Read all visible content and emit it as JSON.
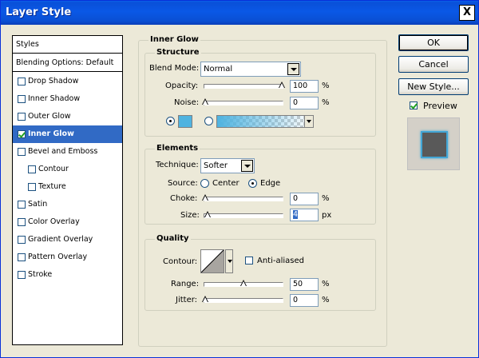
{
  "window": {
    "title": "Layer Style",
    "close_glyph": "X"
  },
  "left_panel": {
    "styles_label": "Styles",
    "blending_label": "Blending Options: Default",
    "items": [
      {
        "label": "Drop Shadow",
        "checked": false
      },
      {
        "label": "Inner Shadow",
        "checked": false
      },
      {
        "label": "Outer Glow",
        "checked": false
      },
      {
        "label": "Inner Glow",
        "checked": true,
        "selected": true
      },
      {
        "label": "Bevel and Emboss",
        "checked": false
      },
      {
        "label": "Contour",
        "checked": false,
        "indent": true
      },
      {
        "label": "Texture",
        "checked": false,
        "indent": true
      },
      {
        "label": "Satin",
        "checked": false
      },
      {
        "label": "Color Overlay",
        "checked": false
      },
      {
        "label": "Gradient Overlay",
        "checked": false
      },
      {
        "label": "Pattern Overlay",
        "checked": false
      },
      {
        "label": "Stroke",
        "checked": false
      }
    ]
  },
  "main": {
    "section_title": "Inner Glow",
    "structure": {
      "title": "Structure",
      "blend_mode_label": "Blend Mode:",
      "blend_mode_value": "Normal",
      "opacity_label": "Opacity:",
      "opacity_value": "100",
      "opacity_level": 100,
      "noise_label": "Noise:",
      "noise_value": "0",
      "noise_level": 0,
      "unit_percent": "%",
      "color": "#4FB3E0"
    },
    "elements": {
      "title": "Elements",
      "technique_label": "Technique:",
      "technique_value": "Softer",
      "source_label": "Source:",
      "source_center": "Center",
      "source_edge": "Edge",
      "choke_label": "Choke:",
      "choke_value": "0",
      "size_label": "Size:",
      "size_value": "4",
      "unit_percent": "%",
      "unit_px": "px"
    },
    "quality": {
      "title": "Quality",
      "contour_label": "Contour:",
      "anti_aliased_label": "Anti-aliased",
      "range_label": "Range:",
      "range_value": "50",
      "range_level": 50,
      "jitter_label": "Jitter:",
      "jitter_value": "0",
      "jitter_level": 0,
      "unit_percent": "%"
    }
  },
  "right": {
    "ok_label": "OK",
    "cancel_label": "Cancel",
    "new_style_label": "New Style...",
    "preview_label": "Preview",
    "preview_checked": true
  }
}
